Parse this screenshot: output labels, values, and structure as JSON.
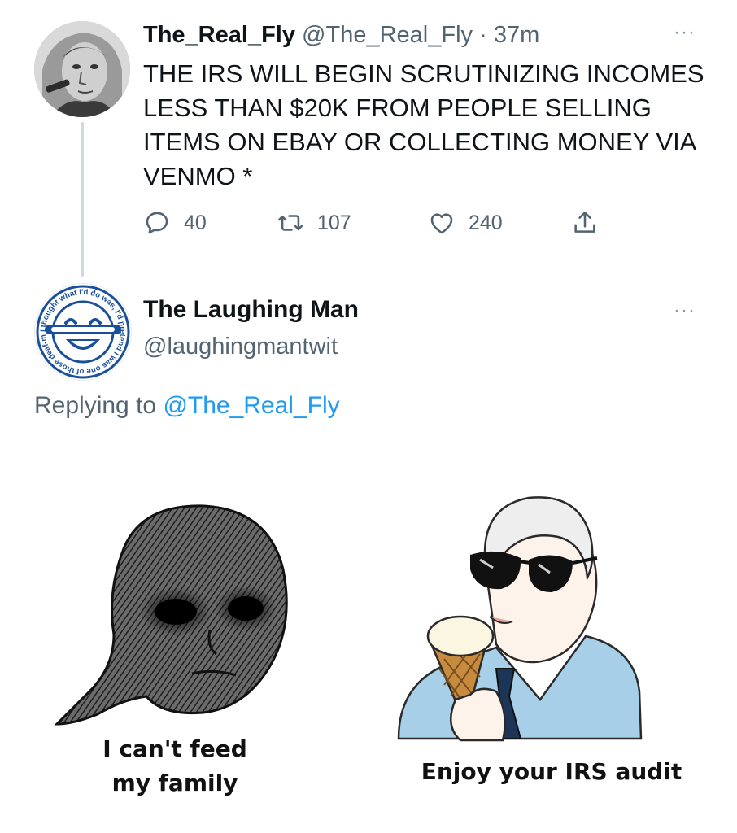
{
  "tweet1": {
    "display_name": "The_Real_Fly",
    "handle": "@The_Real_Fly",
    "separator": "·",
    "time": "37m",
    "text": "THE IRS WILL BEGIN SCRUTINIZING INCOMES LESS THAN $20K FROM PEOPLE SELLING ITEMS ON EBAY OR COLLECTING MONEY VIA VENMO *",
    "more": "···",
    "actions": {
      "reply_count": "40",
      "retweet_count": "107",
      "like_count": "240"
    },
    "icons": {
      "reply": "reply-icon",
      "retweet": "retweet-icon",
      "like": "heart-icon",
      "share": "share-icon"
    }
  },
  "tweet2": {
    "display_name": "The Laughing Man",
    "handle": "@laughingmantwit",
    "more": "···",
    "replying_prefix": "Replying to",
    "replying_to": "@The_Real_Fly",
    "avatar_ring_text": "I thought what I'd do was, I'd pretend I was one of those deaf-mutes"
  },
  "meme": {
    "left_caption_line1": "I can't feed",
    "left_caption_line2": "my family",
    "right_caption": "Enjoy your IRS audit"
  },
  "colors": {
    "text": "#0f1419",
    "secondary": "#536471",
    "link": "#1d9bf0",
    "thread_line": "#cfd9de",
    "laughing_man_blue": "#1a4f9c",
    "shirt_blue": "#a8cfe8"
  }
}
